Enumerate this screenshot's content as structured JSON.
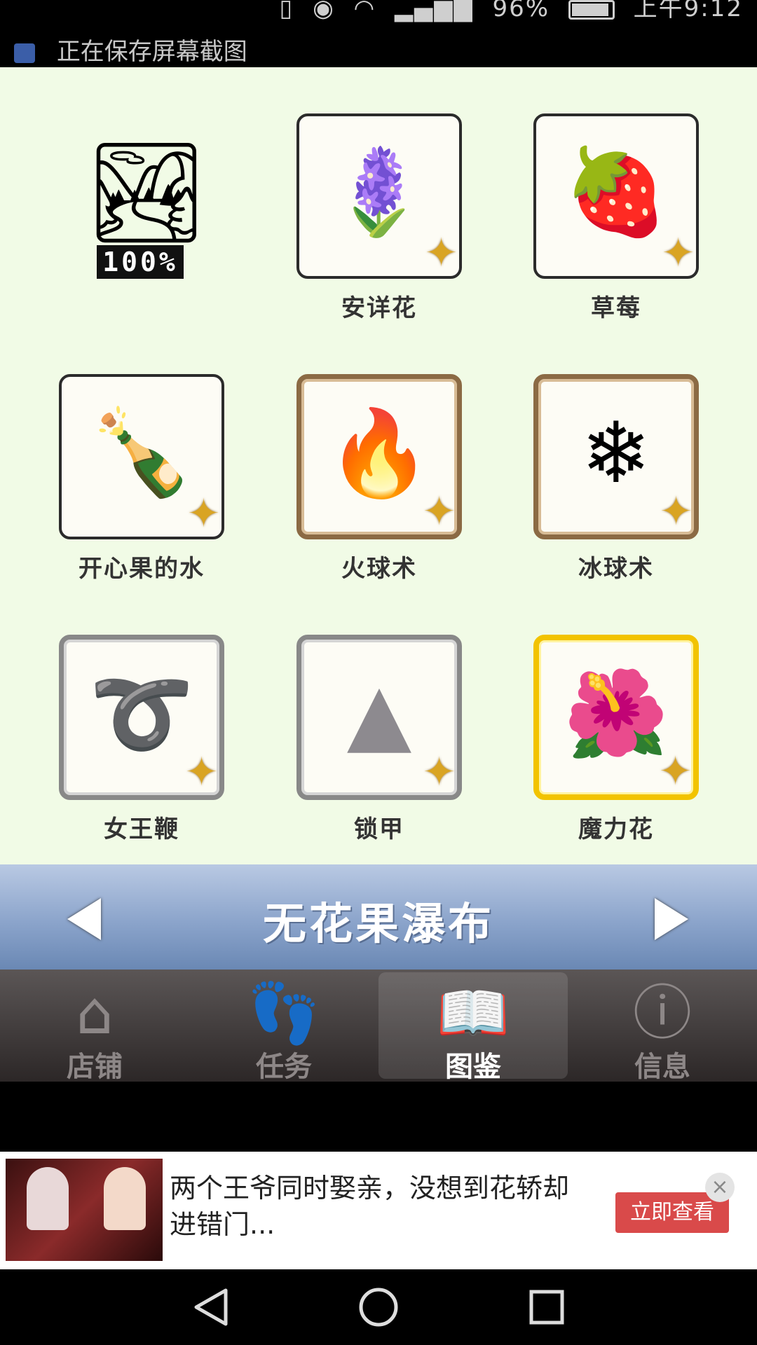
{
  "status_bar": {
    "battery": "96%",
    "time": "上午9:12",
    "notification": "正在保存屏幕截图"
  },
  "collection": {
    "completion": "100%",
    "items": [
      {
        "name": "安详花",
        "icon": "purple-flower-icon",
        "frame": "plain"
      },
      {
        "name": "草莓",
        "icon": "strawberry-icon",
        "frame": "plain"
      },
      {
        "name": "开心果的水",
        "icon": "green-bottle-icon",
        "frame": "plain"
      },
      {
        "name": "火球术",
        "icon": "fireball-icon",
        "frame": "brown"
      },
      {
        "name": "冰球术",
        "icon": "iceball-icon",
        "frame": "brown"
      },
      {
        "name": "女王鞭",
        "icon": "whip-icon",
        "frame": "silver"
      },
      {
        "name": "锁甲",
        "icon": "chainmail-icon",
        "frame": "silver"
      },
      {
        "name": "魔力花",
        "icon": "red-berry-flower-icon",
        "frame": "gold"
      }
    ]
  },
  "title_bar": {
    "title": "无花果瀑布"
  },
  "tabs": [
    {
      "label": "店铺",
      "icon": "house-icon"
    },
    {
      "label": "任务",
      "icon": "footprints-icon"
    },
    {
      "label": "图鉴",
      "icon": "book-icon",
      "active": true
    },
    {
      "label": "信息",
      "icon": "info-bubble-icon"
    }
  ],
  "ad": {
    "text": "两个王爷同时娶亲，没想到花轿却进错门...",
    "button": "立即查看",
    "close": "×"
  }
}
